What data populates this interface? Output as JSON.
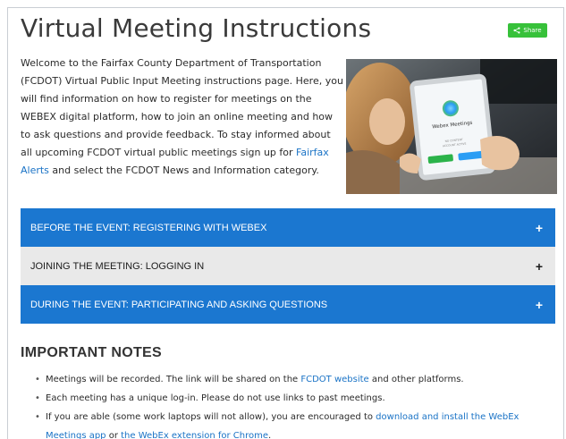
{
  "page": {
    "title": "Virtual Meeting Instructions",
    "share_label": "Share"
  },
  "intro": {
    "text_1": "Welcome to the Fairfax County Department of Transportation (FCDOT) Virtual Public Input Meeting instructions page. Here, you will find information on how to register for meetings on the WEBEX digital platform, how to join an online meeting and how to ask questions and provide feedback. To stay informed about all upcoming FCDOT virtual public meetings sign up for ",
    "link_1": "Fairfax Alerts",
    "text_2": " and select the FCDOT News and Information category."
  },
  "photo": {
    "app_name": "Webex Meetings",
    "screen_text": "NO CONTENT\nACCOUNT ACTIVE"
  },
  "accordion": [
    {
      "label": "BEFORE THE EVENT: REGISTERING WITH WEBEX",
      "icon": "+"
    },
    {
      "label": "JOINING THE MEETING: LOGGING IN",
      "icon": "+"
    },
    {
      "label": "DURING THE EVENT: PARTICIPATING AND ASKING QUESTIONS",
      "icon": "+"
    }
  ],
  "notes": {
    "heading": "IMPORTANT NOTES",
    "item_1_a": "Meetings will be recorded. The link will be shared on the ",
    "item_1_link": "FCDOT website",
    "item_1_b": " and other platforms.",
    "item_2": "Each meeting has a unique log-in. Please do not use links to past meetings.",
    "item_3_a": "If you are able (some work laptops will not allow), you are encouraged to ",
    "item_3_link_1": "download and install the WebEx Meetings app",
    "item_3_b": " or ",
    "item_3_link_2": "the WebEx extension for Chrome",
    "item_3_c": "."
  },
  "colors": {
    "accent_blue": "#1b77d0",
    "link_blue": "#1a73c6",
    "share_green": "#37c13a"
  }
}
